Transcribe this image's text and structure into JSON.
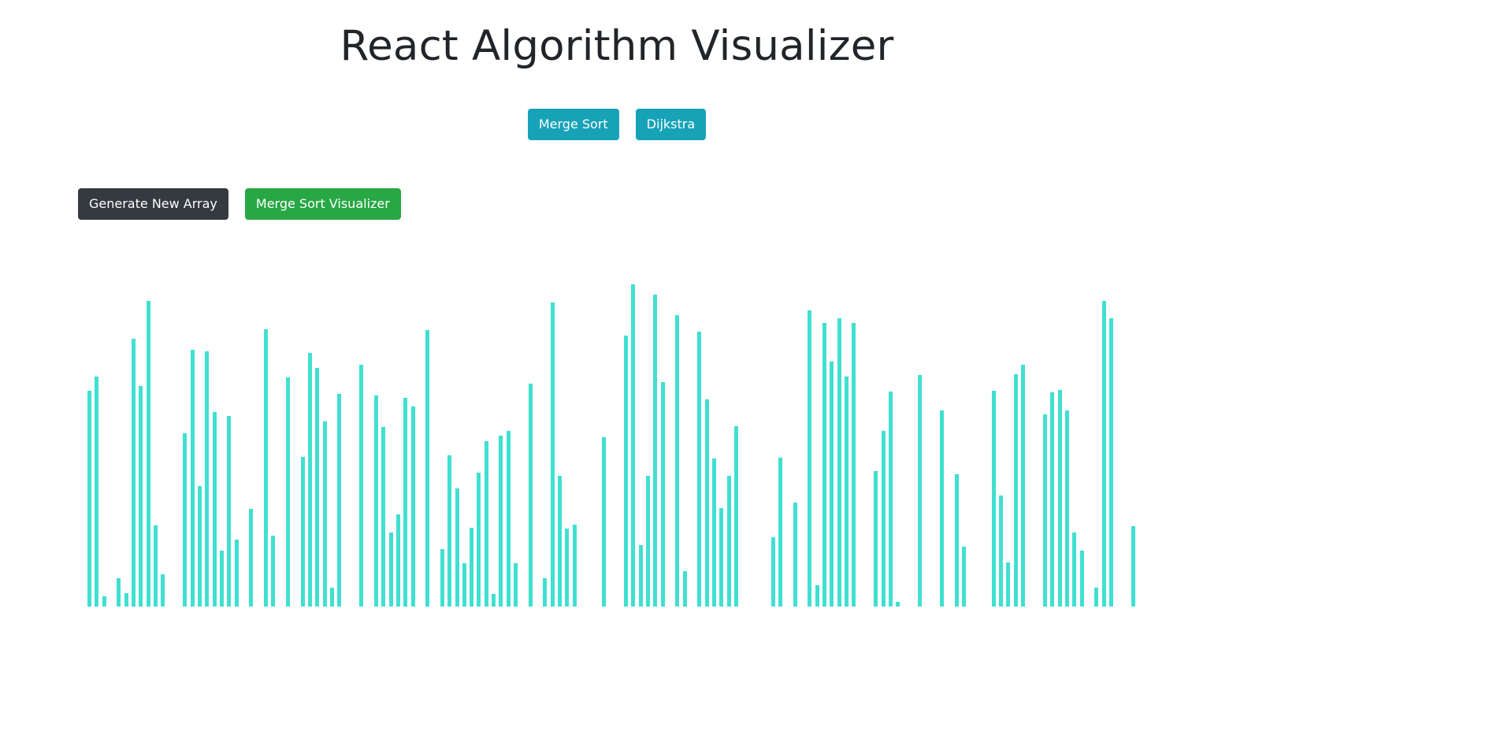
{
  "page": {
    "title": "React Algorithm Visualizer"
  },
  "nav": {
    "merge_sort_label": "Merge Sort",
    "dijkstra_label": "Dijkstra"
  },
  "controls": {
    "generate_label": "Generate New Array",
    "visualize_label": "Merge Sort Visualizer"
  },
  "colors": {
    "bar": "#40e0d0",
    "nav_button": "#17a2b8",
    "generate_button": "#343a40",
    "visualize_button": "#28a745"
  },
  "array": {
    "values": [
      273,
      291,
      13,
      0,
      36,
      17,
      339,
      279,
      387,
      103,
      41,
      0,
      0,
      219,
      325,
      153,
      323,
      246,
      71,
      241,
      85,
      0,
      124,
      0,
      351,
      90,
      0,
      290,
      0,
      190,
      321,
      302,
      234,
      24,
      269,
      0,
      0,
      306,
      0,
      267,
      227,
      94,
      117,
      264,
      253,
      0,
      350,
      0,
      73,
      192,
      150,
      55,
      100,
      170,
      209,
      16,
      216,
      222,
      55,
      0,
      282,
      0,
      36,
      385,
      166,
      99,
      104,
      0,
      0,
      0,
      214,
      0,
      0,
      343,
      408,
      78,
      166,
      395,
      284,
      0,
      369,
      45,
      0,
      348,
      262,
      188,
      125,
      166,
      228,
      0,
      0,
      0,
      0,
      88,
      189,
      0,
      132,
      0,
      375,
      27,
      359,
      310,
      365,
      291,
      359,
      0,
      0,
      172,
      222,
      272,
      6,
      0,
      0,
      293,
      0,
      0,
      248,
      0,
      168,
      76,
      0,
      0,
      0,
      273,
      141,
      56,
      294,
      306,
      0,
      0,
      243,
      271,
      274,
      248,
      94,
      71,
      0,
      24,
      387,
      365,
      0,
      0,
      102
    ],
    "max_value": 408
  }
}
